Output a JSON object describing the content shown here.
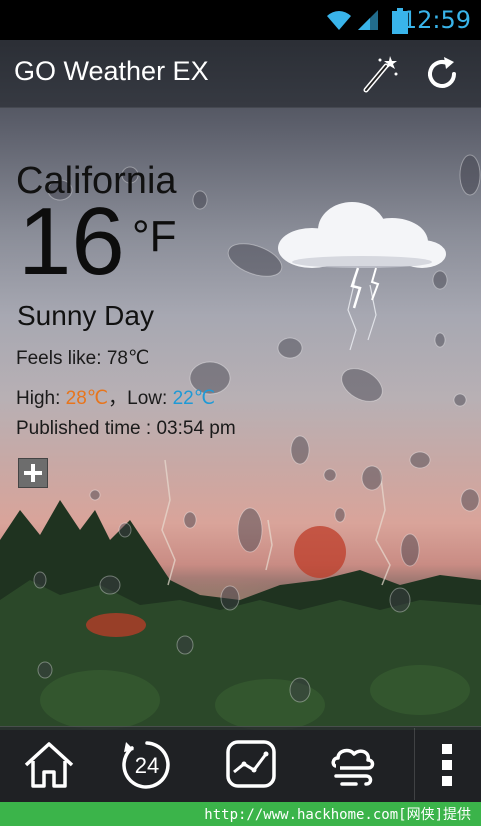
{
  "status_bar": {
    "time": "12:59"
  },
  "app_bar": {
    "title": "GO Weather EX"
  },
  "weather": {
    "city": "California",
    "temperature": "16",
    "unit": "°F",
    "condition": "Sunny Day",
    "feels_like_label": "Feels like: ",
    "feels_like_value": "78℃",
    "high_label": "High: ",
    "high_value": "28℃",
    "separator": "，",
    "low_label": "Low: ",
    "low_value": "22℃",
    "published": "Published time : 03:54 pm"
  },
  "nav": {
    "hours_label": "24"
  },
  "watermark": {
    "text": "http://www.hackhome.com[网侠]提供"
  },
  "colors": {
    "time": "#39b4ea",
    "high": "#e8751c",
    "low": "#1e9ad6",
    "watermark_bg": "#3bb44a"
  }
}
